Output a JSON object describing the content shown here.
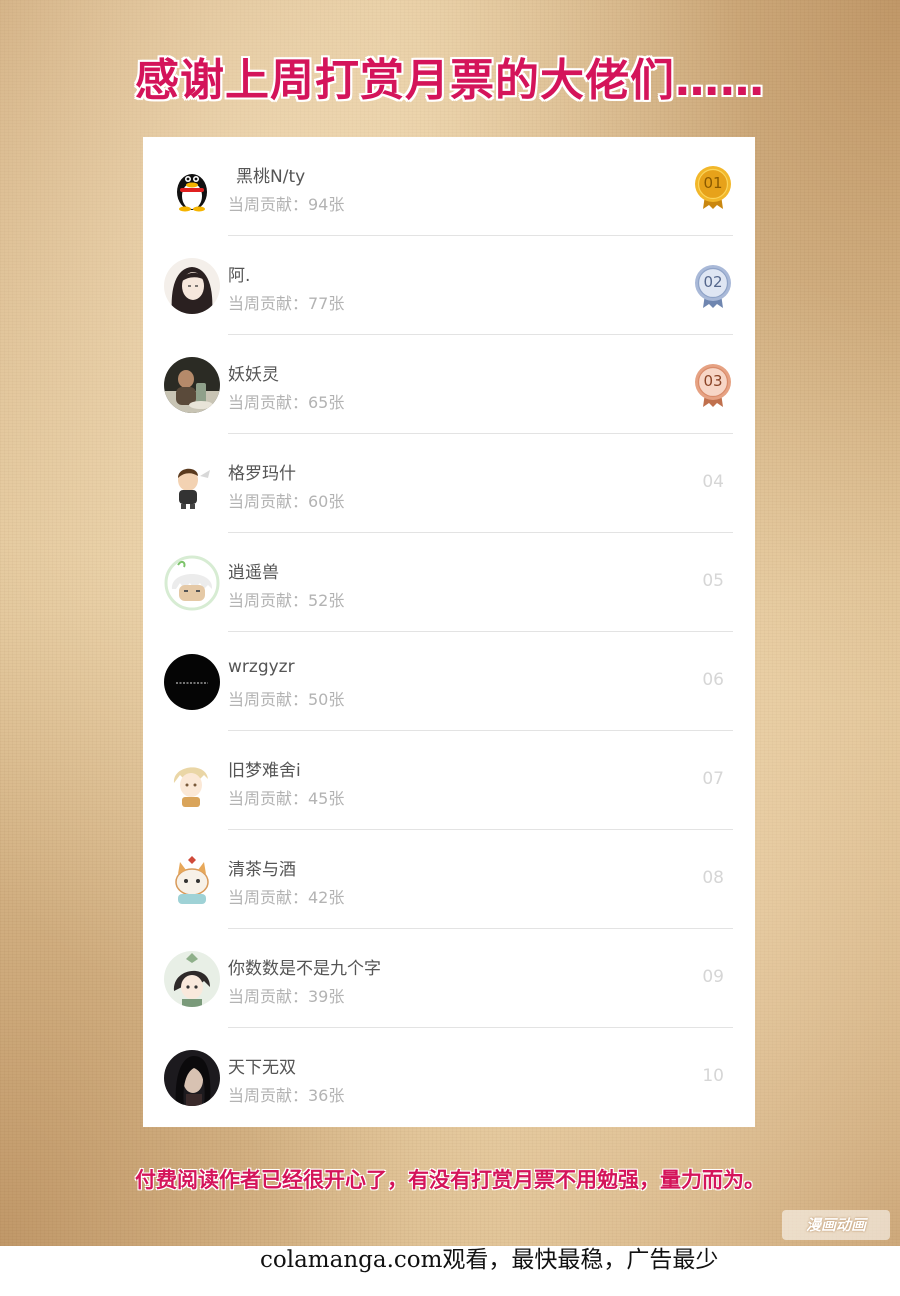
{
  "headline": "感谢上周打赏月票的大佬们……",
  "leaderboard": [
    {
      "rank": "01",
      "name": "黑桃N/ty",
      "contribution": "当周贡献：94张",
      "avatar": "penguin-avatar"
    },
    {
      "rank": "02",
      "name": "阿.",
      "contribution": "当周贡献：77张",
      "avatar": "long-hair-avatar"
    },
    {
      "rank": "03",
      "name": "妖妖灵",
      "contribution": "当周贡献：65张",
      "avatar": "photo-avatar"
    },
    {
      "rank": "04",
      "name": "格罗玛什",
      "contribution": "当周贡献：60张",
      "avatar": "cartoon-boy-avatar"
    },
    {
      "rank": "05",
      "name": "逍遥兽",
      "contribution": "当周贡献：52张",
      "avatar": "white-hair-avatar"
    },
    {
      "rank": "06",
      "name": "wrzgyzr",
      "contribution": "当周贡献：50张",
      "avatar": "black-circle-avatar"
    },
    {
      "rank": "07",
      "name": "旧梦难舍i",
      "contribution": "当周贡献：45张",
      "avatar": "blonde-boy-avatar"
    },
    {
      "rank": "08",
      "name": "清茶与酒",
      "contribution": "当周贡献：42张",
      "avatar": "cat-avatar"
    },
    {
      "rank": "09",
      "name": "你数数是不是九个字",
      "contribution": "当周贡献：39张",
      "avatar": "anime-avatar"
    },
    {
      "rank": "10",
      "name": "天下无双",
      "contribution": "当周贡献：36张",
      "avatar": "dark-hair-avatar"
    }
  ],
  "medal_colors": {
    "gold": "#e7a21a",
    "silver": "#8fa3c7",
    "bronze": "#d98b6a"
  },
  "footer": "付费阅读作者已经很开心了，有没有打赏月票不用勉强，量力而为。",
  "stamp": "漫画动画",
  "watermark": "colamanga.com观看，最快最稳，广告最少",
  "colors": {
    "accent": "#d4145a",
    "paper": "#e3c79a"
  }
}
